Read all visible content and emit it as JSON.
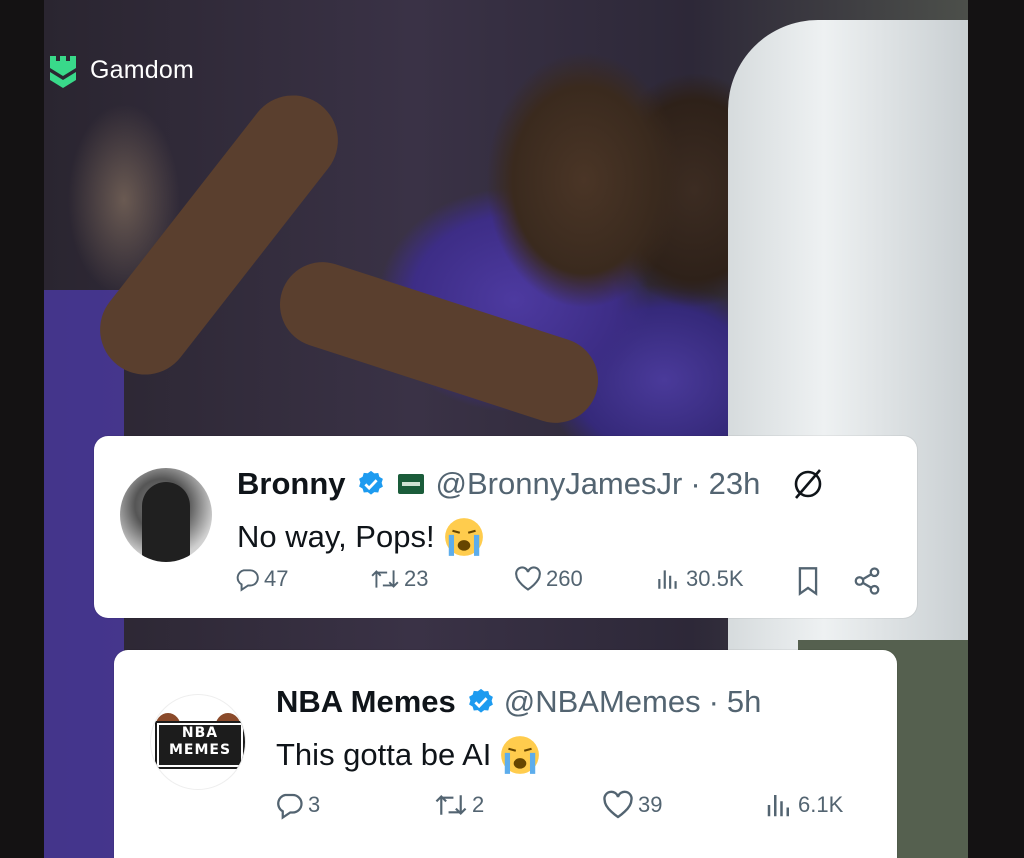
{
  "brand": {
    "name": "Gamdom",
    "color": "#39d98a"
  },
  "posts": [
    {
      "name": "Bronny",
      "handle": "@BronnyJamesJr",
      "time": "23h",
      "text": "No way, Pops!",
      "emoji": "loudly-crying-face",
      "stats": {
        "replies": "47",
        "reposts": "23",
        "likes": "260",
        "views": "30.5K"
      }
    },
    {
      "name": "NBA Memes",
      "handle": "@NBAMemes",
      "time": "5h",
      "text": "This gotta be AI",
      "emoji": "loudly-crying-face",
      "avatar_text": "NBA MEMES",
      "stats": {
        "replies": "3",
        "reposts": "2",
        "likes": "39",
        "views": "6.1K"
      }
    }
  ],
  "separator": "·",
  "colors": {
    "verified": "#1d9bf0",
    "muted": "#536471",
    "text": "#0f1419"
  }
}
